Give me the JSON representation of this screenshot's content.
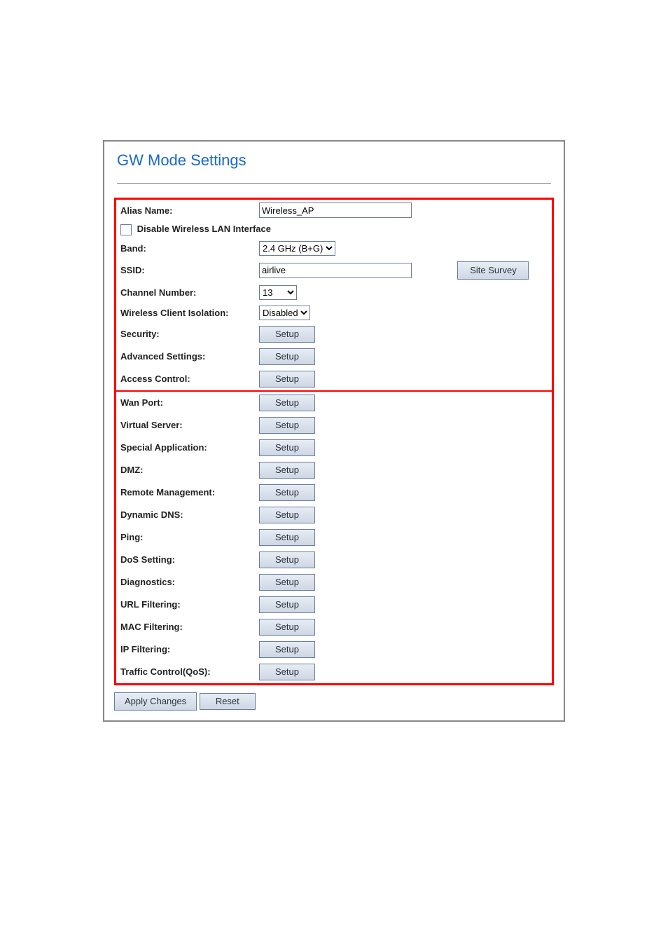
{
  "title": "GW Mode Settings",
  "fields": {
    "alias_name": {
      "label": "Alias Name:",
      "value": "Wireless_AP"
    },
    "disable_wlan": {
      "label": "Disable Wireless LAN Interface",
      "checked": false
    },
    "band": {
      "label": "Band:",
      "value": "2.4 GHz (B+G)"
    },
    "ssid": {
      "label": "SSID:",
      "value": "airlive"
    },
    "site_survey_btn": "Site Survey",
    "channel": {
      "label": "Channel Number:",
      "value": "13"
    },
    "isolation": {
      "label": "Wireless Client Isolation:",
      "value": "Disabled"
    }
  },
  "setup_label": "Setup",
  "rows_top": [
    {
      "label": "Security:"
    },
    {
      "label": "Advanced Settings:"
    },
    {
      "label": "Access Control:"
    }
  ],
  "rows_bottom": [
    {
      "label": "Wan Port:"
    },
    {
      "label": "Virtual Server:"
    },
    {
      "label": "Special Application:"
    },
    {
      "label": "DMZ:"
    },
    {
      "label": "Remote Management:"
    },
    {
      "label": "Dynamic DNS:"
    },
    {
      "label": "Ping:"
    },
    {
      "label": "DoS Setting:"
    },
    {
      "label": "Diagnostics:"
    },
    {
      "label": "URL Filtering:"
    },
    {
      "label": "MAC Filtering:"
    },
    {
      "label": "IP Filtering:"
    },
    {
      "label": "Traffic Control(QoS):"
    }
  ],
  "footer": {
    "apply": "Apply Changes",
    "reset": "Reset"
  }
}
